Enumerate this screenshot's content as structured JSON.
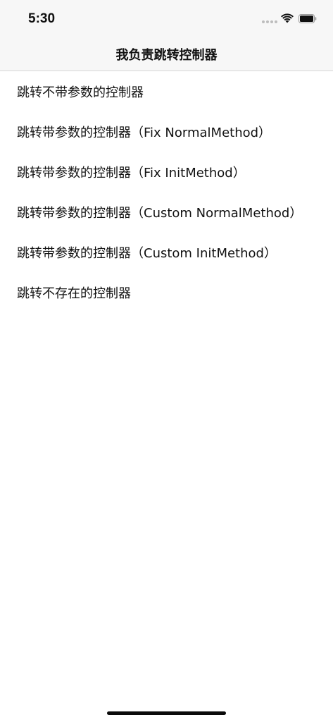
{
  "status_bar": {
    "time": "5:30"
  },
  "nav": {
    "title": "我负责跳转控制器"
  },
  "list": {
    "items": [
      {
        "label": "跳转不带参数的控制器"
      },
      {
        "label": "跳转带参数的控制器（Fix NormalMethod）"
      },
      {
        "label": "跳转带参数的控制器（Fix InitMethod）"
      },
      {
        "label": "跳转带参数的控制器（Custom NormalMethod）"
      },
      {
        "label": "跳转带参数的控制器（Custom InitMethod）"
      },
      {
        "label": "跳转不存在的控制器"
      }
    ]
  },
  "icons": {
    "signal": "cellular-signal-icon",
    "wifi": "wifi-icon",
    "battery": "battery-icon"
  },
  "colors": {
    "background": "#ffffff",
    "bar_background": "#f7f7f7",
    "separator": "#d6d6d6",
    "text": "#111111"
  }
}
